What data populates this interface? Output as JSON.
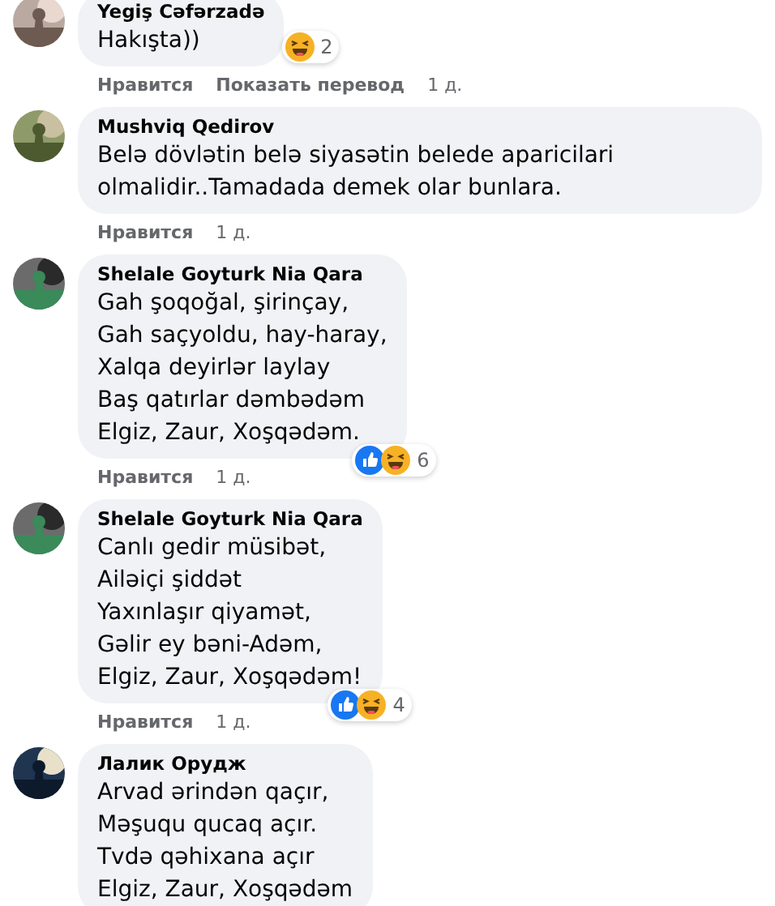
{
  "comments": [
    {
      "author": "Yegiş Cəfərzadə",
      "lines": [
        "Hakışta))"
      ],
      "reactions": [
        {
          "kind": "haha"
        }
      ],
      "reaction_count": "2",
      "actions": [
        {
          "label": "Нравится",
          "kind": "link"
        },
        {
          "label": "Показать перевод",
          "kind": "link"
        },
        {
          "label": "1 д.",
          "kind": "time"
        }
      ]
    },
    {
      "author": "Mushviq Qedirov",
      "lines": [
        "Belə dövlətin belə siyasətin belede aparicilari olmalidir..Tamadada demek olar bunlara."
      ],
      "actions": [
        {
          "label": "Нравится",
          "kind": "link"
        },
        {
          "label": "1 д.",
          "kind": "time"
        }
      ]
    },
    {
      "author": "Shelale Goyturk Nia Qara",
      "lines": [
        "Gah şoqoğal, şirinçay,",
        "Gah saçyoldu, hay-haray,",
        "Xalqa deyirlər laylay",
        "Baş qatırlar dəmbədəm",
        "Elgiz, Zaur, Xoşqədəm."
      ],
      "reactions": [
        {
          "kind": "like"
        },
        {
          "kind": "haha"
        }
      ],
      "reaction_count": "6",
      "actions": [
        {
          "label": "Нравится",
          "kind": "link"
        },
        {
          "label": "1 д.",
          "kind": "time"
        }
      ]
    },
    {
      "author": "Shelale Goyturk Nia Qara",
      "lines": [
        "Canlı gedir müsibət,",
        "Ailəiçi şiddət",
        "Yaxınlaşır qiyamət,",
        "Gəlir ey bəni-Adəm,",
        "Elgiz, Zaur, Xoşqədəm!"
      ],
      "reactions": [
        {
          "kind": "like"
        },
        {
          "kind": "haha"
        }
      ],
      "reaction_count": "4",
      "actions": [
        {
          "label": "Нравится",
          "kind": "link"
        },
        {
          "label": "1 д.",
          "kind": "time"
        }
      ]
    },
    {
      "author": "Лалик Орудж",
      "lines": [
        "Arvad ərindən qaçır,",
        "Məşuqu qucaq açır.",
        "Tvdə qəhixana açır",
        "Elgiz, Zaur, Xoşqədəm"
      ]
    }
  ]
}
